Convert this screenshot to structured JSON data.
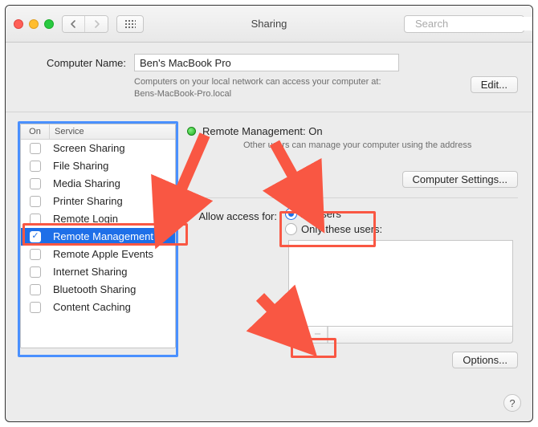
{
  "window": {
    "title": "Sharing",
    "search_placeholder": "Search"
  },
  "computer_name": {
    "label": "Computer Name:",
    "value": "Ben's MacBook Pro",
    "help_text": "Computers on your local network can access your computer at:",
    "hostname": "Bens-MacBook-Pro.local",
    "edit_button": "Edit..."
  },
  "services": {
    "header_on": "On",
    "header_service": "Service",
    "items": [
      {
        "label": "Screen Sharing",
        "on": false,
        "selected": false
      },
      {
        "label": "File Sharing",
        "on": false,
        "selected": false
      },
      {
        "label": "Media Sharing",
        "on": false,
        "selected": false
      },
      {
        "label": "Printer Sharing",
        "on": false,
        "selected": false
      },
      {
        "label": "Remote Login",
        "on": false,
        "selected": false
      },
      {
        "label": "Remote Management",
        "on": true,
        "selected": true
      },
      {
        "label": "Remote Apple Events",
        "on": false,
        "selected": false
      },
      {
        "label": "Internet Sharing",
        "on": false,
        "selected": false
      },
      {
        "label": "Bluetooth Sharing",
        "on": false,
        "selected": false
      },
      {
        "label": "Content Caching",
        "on": false,
        "selected": false
      }
    ]
  },
  "status": {
    "title": "Remote Management: On",
    "subtitle": "Other users can manage your computer using the address",
    "computer_settings_button": "Computer Settings..."
  },
  "access": {
    "label": "Allow access for:",
    "options": [
      {
        "label": "All users",
        "selected": true
      },
      {
        "label": "Only these users:",
        "selected": false
      }
    ],
    "add_label": "+",
    "remove_label": "−",
    "options_button": "Options..."
  },
  "lock_hint": "",
  "help_label": "?"
}
